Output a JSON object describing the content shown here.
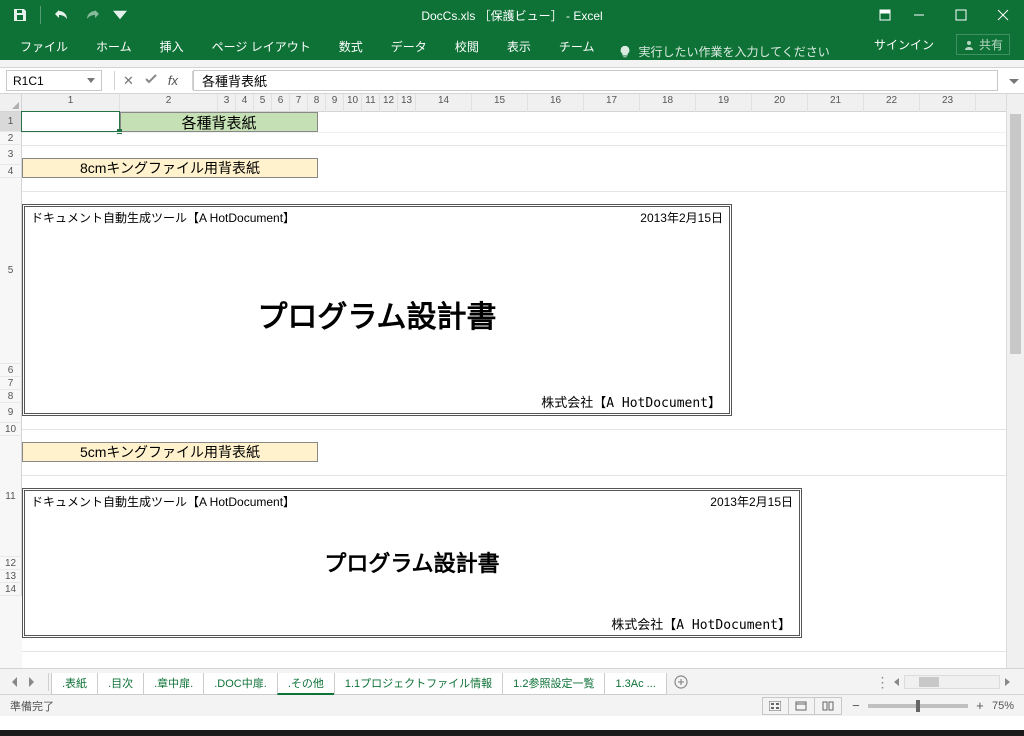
{
  "title": "DocCs.xls ［保護ビュー］ - Excel",
  "ribbon": {
    "tabs": [
      "ファイル",
      "ホーム",
      "挿入",
      "ページ レイアウト",
      "数式",
      "データ",
      "校閲",
      "表示",
      "チーム"
    ],
    "tellme": "実行したい作業を入力してください",
    "signin": "サインイン",
    "share": "共有"
  },
  "formula": {
    "namebox": "R1C1",
    "fx": "fx",
    "value": "各種背表紙"
  },
  "ruler_cols": [
    1,
    2,
    3,
    4,
    5,
    6,
    7,
    8,
    9,
    10,
    11,
    12,
    13,
    14,
    15,
    16,
    17,
    18,
    19,
    20,
    21,
    22,
    23
  ],
  "rows": [
    1,
    2,
    3,
    4,
    5,
    6,
    7,
    8,
    9,
    10,
    11,
    12,
    13,
    14
  ],
  "cells": {
    "title_main": "各種背表紙",
    "header8cm": "8cmキングファイル用背表紙",
    "header5cm": "5cmキングファイル用背表紙",
    "doc1": {
      "tool": "ドキュメント自動生成ツール【A HotDocument】",
      "date": "2013年2月15日",
      "title": "プログラム設計書",
      "company": "株式会社【A HotDocument】"
    },
    "doc2": {
      "tool": "ドキュメント自動生成ツール【A HotDocument】",
      "date": "2013年2月15日",
      "title": "プログラム設計書",
      "company": "株式会社【A HotDocument】"
    }
  },
  "sheets": {
    "tabs": [
      ".表紙",
      ".目次",
      ".章中扉.",
      ".DOC中扉.",
      ".その他",
      "1.1プロジェクトファイル情報",
      "1.2参照設定一覧",
      "1.3Ac"
    ],
    "active_index": 4,
    "more": "..."
  },
  "status": {
    "ready": "準備完了",
    "zoom": "75%"
  }
}
